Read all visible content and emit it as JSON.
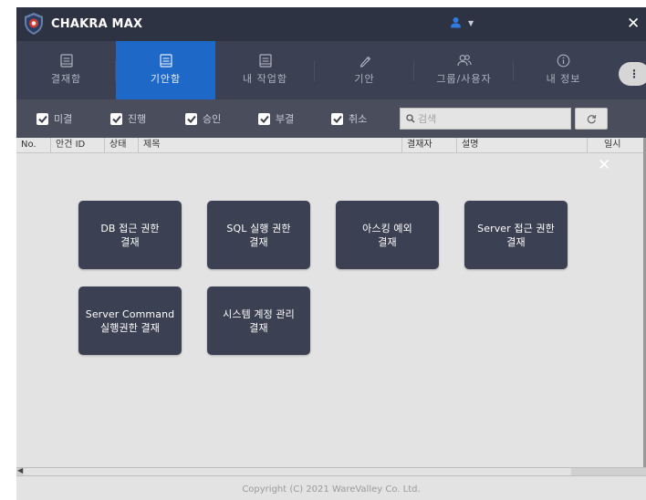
{
  "app": {
    "title": "CHAKRA MAX"
  },
  "nav": {
    "items": [
      {
        "label": "결재함",
        "icon": "inbox-doc-icon",
        "active": false
      },
      {
        "label": "기안함",
        "icon": "draft-doc-icon",
        "active": true
      },
      {
        "label": "내 작업함",
        "icon": "my-tasks-icon",
        "active": false
      },
      {
        "label": "기안",
        "icon": "pencil-icon",
        "active": false
      },
      {
        "label": "그룹/사용자",
        "icon": "users-icon",
        "active": false
      },
      {
        "label": "내 정보",
        "icon": "info-icon",
        "active": false
      }
    ],
    "more": "⋮"
  },
  "filters": [
    {
      "label": "미결",
      "checked": true
    },
    {
      "label": "진행",
      "checked": true
    },
    {
      "label": "승인",
      "checked": true
    },
    {
      "label": "부결",
      "checked": true
    },
    {
      "label": "취소",
      "checked": true
    }
  ],
  "search": {
    "placeholder": "검색",
    "value": ""
  },
  "table": {
    "columns": [
      "No.",
      "안건 ID",
      "상태",
      "제목",
      "결재자",
      "설명",
      "일시"
    ]
  },
  "tiles": [
    {
      "label": "DB 접근 권한\n결재"
    },
    {
      "label": "SQL 실행 권한\n결재"
    },
    {
      "label": "아스킹 예외\n결재"
    },
    {
      "label": "Server 접근 권한\n결재"
    },
    {
      "label": "Server Command\n실행권한 결재"
    },
    {
      "label": "시스템 계정 관리\n결재"
    }
  ],
  "footer": {
    "copyright": "Copyright (C) 2021 WareValley Co. Ltd."
  },
  "colors": {
    "titlebar": "#2e3344",
    "nav": "#3b4052",
    "nav_active": "#1e68c7",
    "filterbar": "#4a4d5c",
    "tile": "#3b4052",
    "logo_accent": "#c0392b"
  }
}
